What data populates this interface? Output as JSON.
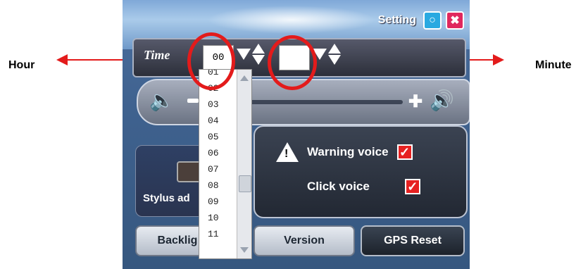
{
  "annotations": {
    "hour_label": "Hour",
    "minute_label": "Minute"
  },
  "title_bar": {
    "title": "Setting",
    "settings_icon": "settings-icon",
    "close_icon": "close-icon"
  },
  "time": {
    "label": "Time",
    "hour_value": "00",
    "minute_value": ""
  },
  "hour_dropdown": {
    "items": [
      "01",
      "02",
      "03",
      "04",
      "05",
      "06",
      "07",
      "08",
      "09",
      "10",
      "11"
    ]
  },
  "audio": {
    "warning_voice_label": "Warning voice",
    "click_voice_label": "Click voice",
    "warning_voice_checked": true,
    "click_voice_checked": true
  },
  "stylus": {
    "label": "Stylus ad"
  },
  "buttons": {
    "backlight": "Backlig",
    "version": "Version",
    "gps_reset": "GPS Reset"
  },
  "colors": {
    "annotation_red": "#e31b1b",
    "settings_blue": "#29a9e1",
    "close_pink": "#e0285e",
    "check_red": "#e62121"
  }
}
